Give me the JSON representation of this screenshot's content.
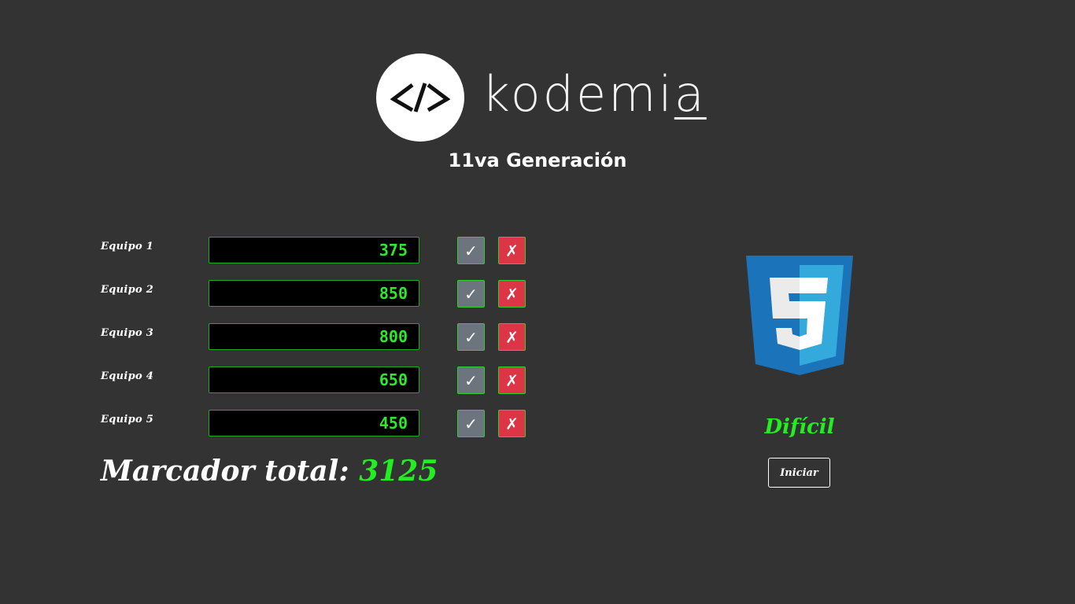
{
  "header": {
    "logo_text_main": "kodemi",
    "logo_text_last": "a",
    "generation": "11va Generación"
  },
  "teams": [
    {
      "label": "Equipo 1",
      "score": "375"
    },
    {
      "label": "Equipo 2",
      "score": "850"
    },
    {
      "label": "Equipo 3",
      "score": "800"
    },
    {
      "label": "Equipo 4",
      "score": "650"
    },
    {
      "label": "Equipo 5",
      "score": "450"
    }
  ],
  "controls": {
    "correct_symbol": "✓",
    "wrong_symbol": "✗"
  },
  "total": {
    "label": "Marcador total:",
    "value": "3125"
  },
  "question_panel": {
    "topic_icon": "css3-icon",
    "difficulty": "Difícil",
    "start_label": "Iniciar"
  },
  "colors": {
    "background": "#333333",
    "score_green": "#2ee82e",
    "correct_button": "#6c757d",
    "wrong_button": "#dc3545",
    "css_blue_dark": "#1b73ba",
    "css_blue_light": "#33a9dc"
  }
}
